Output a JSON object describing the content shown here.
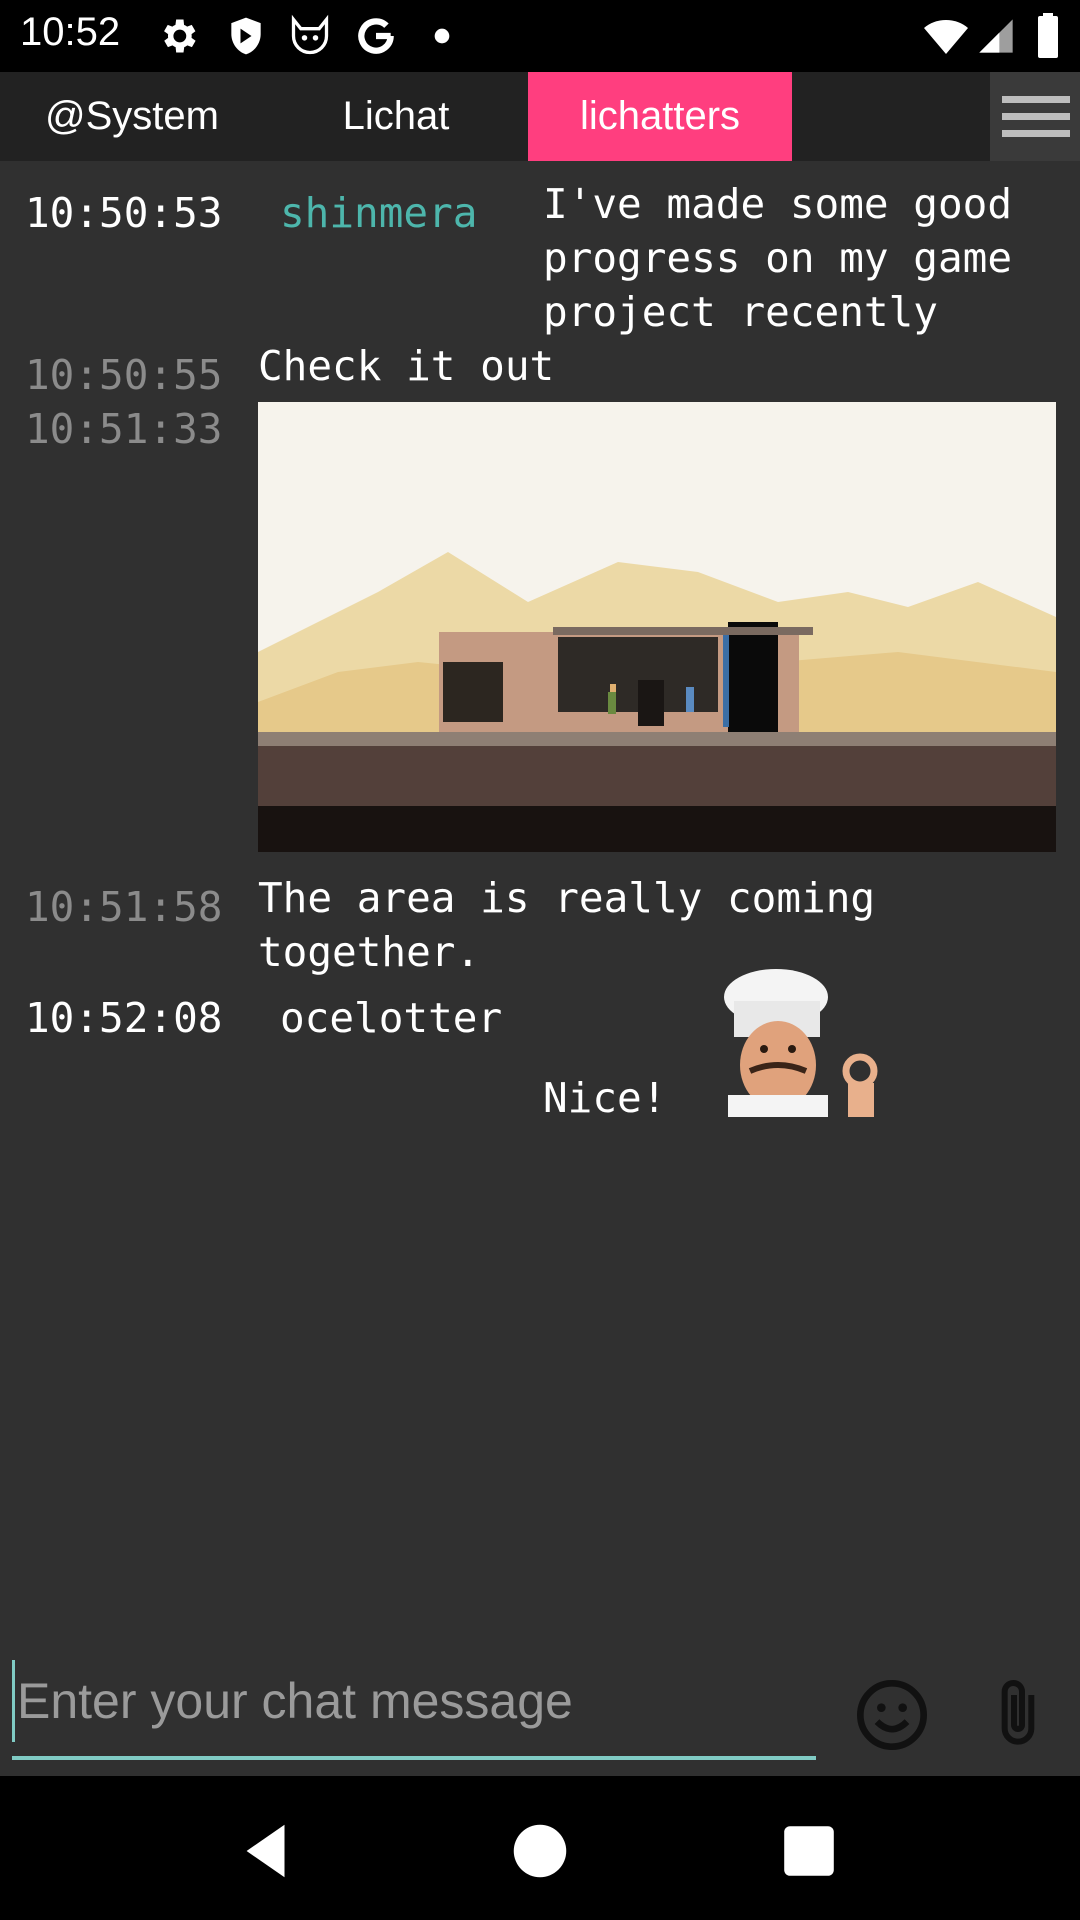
{
  "status_bar": {
    "time": "10:52",
    "icons": [
      "settings-icon",
      "shield-icon",
      "cat-icon",
      "google-icon",
      "dot-icon",
      "wifi-icon",
      "signal-icon",
      "battery-icon"
    ]
  },
  "tabs": [
    {
      "label": "@System",
      "active": false
    },
    {
      "label": "Lichat",
      "active": false
    },
    {
      "label": "lichatters",
      "active": true
    }
  ],
  "colors": {
    "accent": "#ff3e7f",
    "author_shinmera": "#4db6ac",
    "input_underline": "#80cbc4"
  },
  "messages": [
    {
      "time": "10:50:53",
      "author": "shinmera",
      "lines": [
        "I've made some good",
        "progress on my game",
        "project recently"
      ]
    },
    {
      "time": "10:50:55",
      "text": "Check it out"
    },
    {
      "time": "10:51:33",
      "image": "game-screenshot"
    },
    {
      "time": "10:51:58",
      "lines": [
        "The area is really coming",
        "together."
      ]
    },
    {
      "time": "10:52:08",
      "author": "ocelotter",
      "text": "Nice!",
      "emote": "chef-kiss-emote"
    }
  ],
  "input": {
    "placeholder": "Enter your chat message"
  },
  "actions": {
    "emoji": "emoji-icon",
    "attach": "paperclip-icon"
  },
  "nav": [
    "back-icon",
    "home-icon",
    "recents-icon"
  ]
}
